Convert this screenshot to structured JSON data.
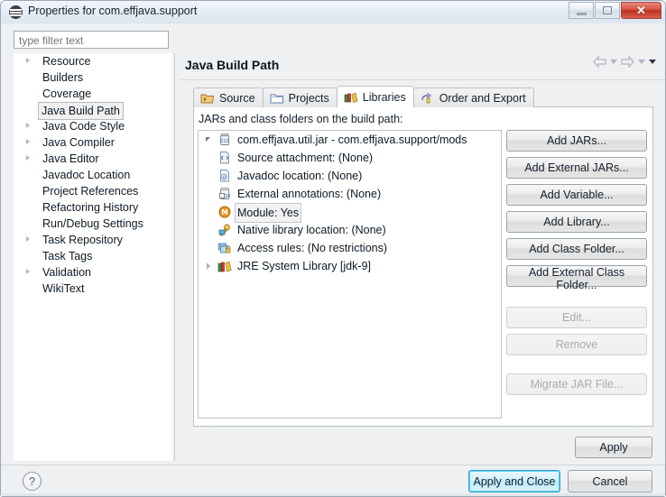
{
  "window": {
    "title": "Properties for com.effjava.support",
    "icon": "eclipse-properties-icon",
    "minimize_label": "Minimize",
    "maximize_label": "Maximize",
    "close_label": "✕"
  },
  "sidebar": {
    "filter_placeholder": "type filter text",
    "filter_value": "",
    "items": [
      {
        "label": "Resource",
        "expandable": true,
        "selected": false
      },
      {
        "label": "Builders",
        "expandable": false,
        "selected": false
      },
      {
        "label": "Coverage",
        "expandable": false,
        "selected": false
      },
      {
        "label": "Java Build Path",
        "expandable": false,
        "selected": true
      },
      {
        "label": "Java Code Style",
        "expandable": true,
        "selected": false
      },
      {
        "label": "Java Compiler",
        "expandable": true,
        "selected": false
      },
      {
        "label": "Java Editor",
        "expandable": true,
        "selected": false
      },
      {
        "label": "Javadoc Location",
        "expandable": false,
        "selected": false
      },
      {
        "label": "Project References",
        "expandable": false,
        "selected": false
      },
      {
        "label": "Refactoring History",
        "expandable": false,
        "selected": false
      },
      {
        "label": "Run/Debug Settings",
        "expandable": false,
        "selected": false
      },
      {
        "label": "Task Repository",
        "expandable": true,
        "selected": false
      },
      {
        "label": "Task Tags",
        "expandable": false,
        "selected": false
      },
      {
        "label": "Validation",
        "expandable": true,
        "selected": false
      },
      {
        "label": "WikiText",
        "expandable": false,
        "selected": false
      }
    ]
  },
  "page": {
    "title": "Java Build Path",
    "nav": {
      "back_icon": "back-arrow-icon",
      "back_menu_icon": "chevron-down-icon",
      "forward_icon": "forward-arrow-icon",
      "forward_menu_icon": "chevron-down-icon",
      "menu_icon": "chevron-down-icon"
    }
  },
  "tabs": [
    {
      "label": "Source",
      "icon": "source-folder-icon",
      "active": false
    },
    {
      "label": "Projects",
      "icon": "project-folder-icon",
      "active": false
    },
    {
      "label": "Libraries",
      "icon": "libraries-books-icon",
      "active": true
    },
    {
      "label": "Order and Export",
      "icon": "order-export-icon",
      "active": false
    }
  ],
  "libraries": {
    "hint": "JARs and class folders on the build path:",
    "tree": [
      {
        "label": "com.effjava.util.jar - com.effjava.support/mods",
        "icon": "jar-icon",
        "level": 0,
        "twisty": "open",
        "selected": false
      },
      {
        "label": "Source attachment: (None)",
        "icon": "source-attachment-icon",
        "level": 1,
        "twisty": "none",
        "selected": false
      },
      {
        "label": "Javadoc location: (None)",
        "icon": "javadoc-icon",
        "level": 1,
        "twisty": "none",
        "selected": false
      },
      {
        "label": "External annotations: (None)",
        "icon": "external-annotations-icon",
        "level": 1,
        "twisty": "none",
        "selected": false
      },
      {
        "label": "Module: Yes",
        "icon": "module-icon",
        "level": 1,
        "twisty": "none",
        "selected": true
      },
      {
        "label": "Native library location: (None)",
        "icon": "native-library-icon",
        "level": 1,
        "twisty": "none",
        "selected": false
      },
      {
        "label": "Access rules: (No restrictions)",
        "icon": "access-rules-icon",
        "level": 1,
        "twisty": "none",
        "selected": false
      },
      {
        "label": "JRE System Library [jdk-9]",
        "icon": "jre-library-icon",
        "level": 0,
        "twisty": "closed",
        "selected": false
      }
    ],
    "buttons": [
      {
        "label": "Add JARs...",
        "enabled": true
      },
      {
        "label": "Add External JARs...",
        "enabled": true
      },
      {
        "label": "Add Variable...",
        "enabled": true
      },
      {
        "label": "Add Library...",
        "enabled": true
      },
      {
        "label": "Add Class Folder...",
        "enabled": true
      },
      {
        "label": "Add External Class Folder...",
        "enabled": true
      },
      {
        "label": "Edit...",
        "enabled": false
      },
      {
        "label": "Remove",
        "enabled": false
      },
      {
        "label": "Migrate JAR File...",
        "enabled": false
      }
    ]
  },
  "footer": {
    "apply_label": "Apply",
    "help_label": "?",
    "apply_and_close_label": "Apply and Close",
    "cancel_label": "Cancel"
  },
  "colors": {
    "accent": "#2f9fd4",
    "close_red": "#bf2e1e",
    "module_orange": "#e8961e"
  }
}
